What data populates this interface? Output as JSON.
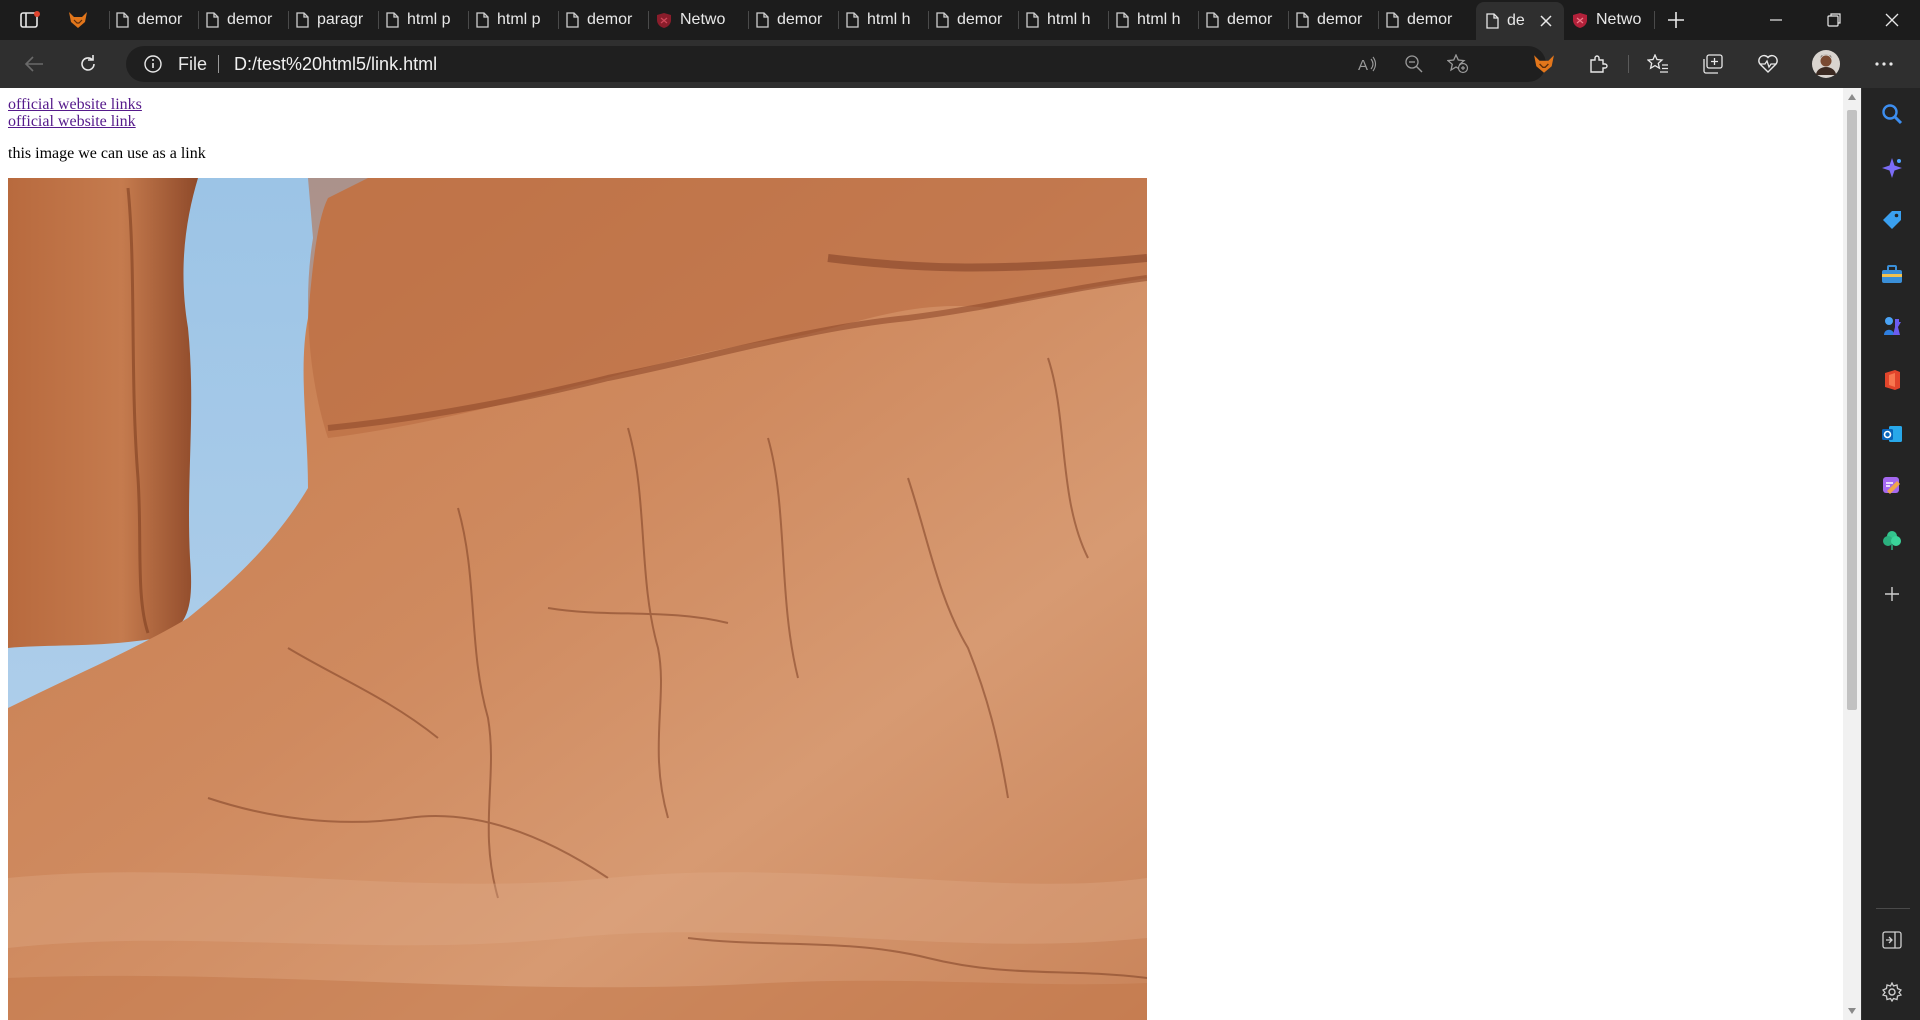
{
  "tabs": [
    {
      "title": "",
      "icon": "fox-icon"
    },
    {
      "title": "demor",
      "icon": "document-icon"
    },
    {
      "title": "demor",
      "icon": "document-icon"
    },
    {
      "title": "paragr",
      "icon": "document-icon"
    },
    {
      "title": "html p",
      "icon": "document-icon"
    },
    {
      "title": "html p",
      "icon": "document-icon"
    },
    {
      "title": "demor",
      "icon": "document-icon"
    },
    {
      "title": "Netwo",
      "icon": "shield-icon"
    },
    {
      "title": "demor",
      "icon": "document-icon"
    },
    {
      "title": "html h",
      "icon": "document-icon"
    },
    {
      "title": "demor",
      "icon": "document-icon"
    },
    {
      "title": "html h",
      "icon": "document-icon"
    },
    {
      "title": "html h",
      "icon": "document-icon"
    },
    {
      "title": "demor",
      "icon": "document-icon"
    },
    {
      "title": "demor",
      "icon": "document-icon"
    },
    {
      "title": "demor",
      "icon": "document-icon"
    },
    {
      "title": "de",
      "icon": "document-icon",
      "active": true
    },
    {
      "title": "Netwo",
      "icon": "shield-icon"
    }
  ],
  "addressbar": {
    "scheme_label": "File",
    "url": "D:/test%20html5/link.html"
  },
  "page": {
    "link1": "official website links",
    "link2": "official website link",
    "caption": "this image we can use as a link",
    "image": "desert sandstone cliff with blue sky"
  },
  "colors": {
    "tabstrip": "#1c1c1c",
    "toolbar": "#2f2f2f",
    "link": "#551a8b",
    "rock": "#c9845a",
    "sky": "#9cc4e6"
  }
}
